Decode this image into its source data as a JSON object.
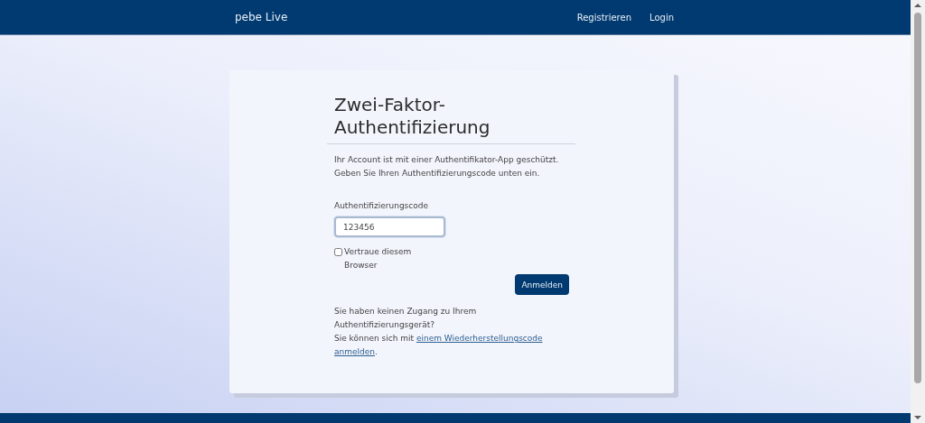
{
  "navbar": {
    "brand": "pebe Live",
    "links": [
      "Registrieren",
      "Login"
    ]
  },
  "form": {
    "title": "Zwei-Faktor-Authentifizierung",
    "intro": [
      "Ihr Account ist mit einer Authentifikator-App geschützt.",
      "Geben Sie Ihren Authentifizierungscode unten ein."
    ],
    "code_label": "Authentifizierungscode",
    "code_value": "123456",
    "remember": {
      "label": "Vertraue diesem Browser",
      "checked": false
    },
    "submit": "Anmelden",
    "no_access": "Sie haben keinen Zugang zu Ihrem Authentifizierungsgerät?",
    "recovery_prefix": "Sie können sich mit ",
    "recovery_link": [
      "einem Wiederherstellungscode",
      "anmelden"
    ],
    "recovery_suffix": "."
  }
}
